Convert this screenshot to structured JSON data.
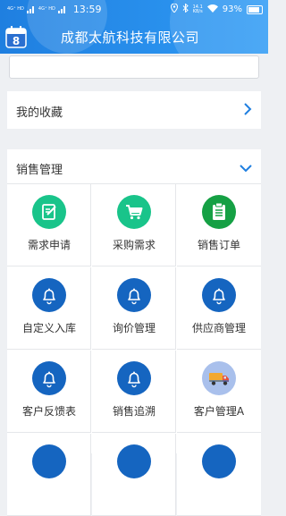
{
  "status": {
    "network": "4G⁺ HD",
    "network2": "4G⁺ HD",
    "time": "13:59",
    "speed_value": "14.1",
    "speed_unit": "KB/s",
    "battery": "93%"
  },
  "header": {
    "company": "成都太航科技有限公司",
    "logo_number": "8"
  },
  "search": {
    "placeholder": ""
  },
  "favorites": {
    "label": "我的收藏"
  },
  "sales": {
    "label": "销售管理",
    "items": [
      {
        "label": "需求申请",
        "icon": "edit-icon"
      },
      {
        "label": "采购需求",
        "icon": "cart-icon"
      },
      {
        "label": "销售订单",
        "icon": "clipboard-icon"
      },
      {
        "label": "自定义入库",
        "icon": "bell-icon"
      },
      {
        "label": "询价管理",
        "icon": "bell-icon"
      },
      {
        "label": "供应商管理",
        "icon": "bell-icon"
      },
      {
        "label": "客户反馈表",
        "icon": "bell-icon"
      },
      {
        "label": "销售追溯",
        "icon": "bell-icon"
      },
      {
        "label": "客户管理A",
        "icon": "truck-icon"
      }
    ]
  },
  "colors": {
    "header": "#1f7fe0",
    "green": "#19c48a",
    "dark_green": "#15a044",
    "blue": "#1565c0"
  }
}
